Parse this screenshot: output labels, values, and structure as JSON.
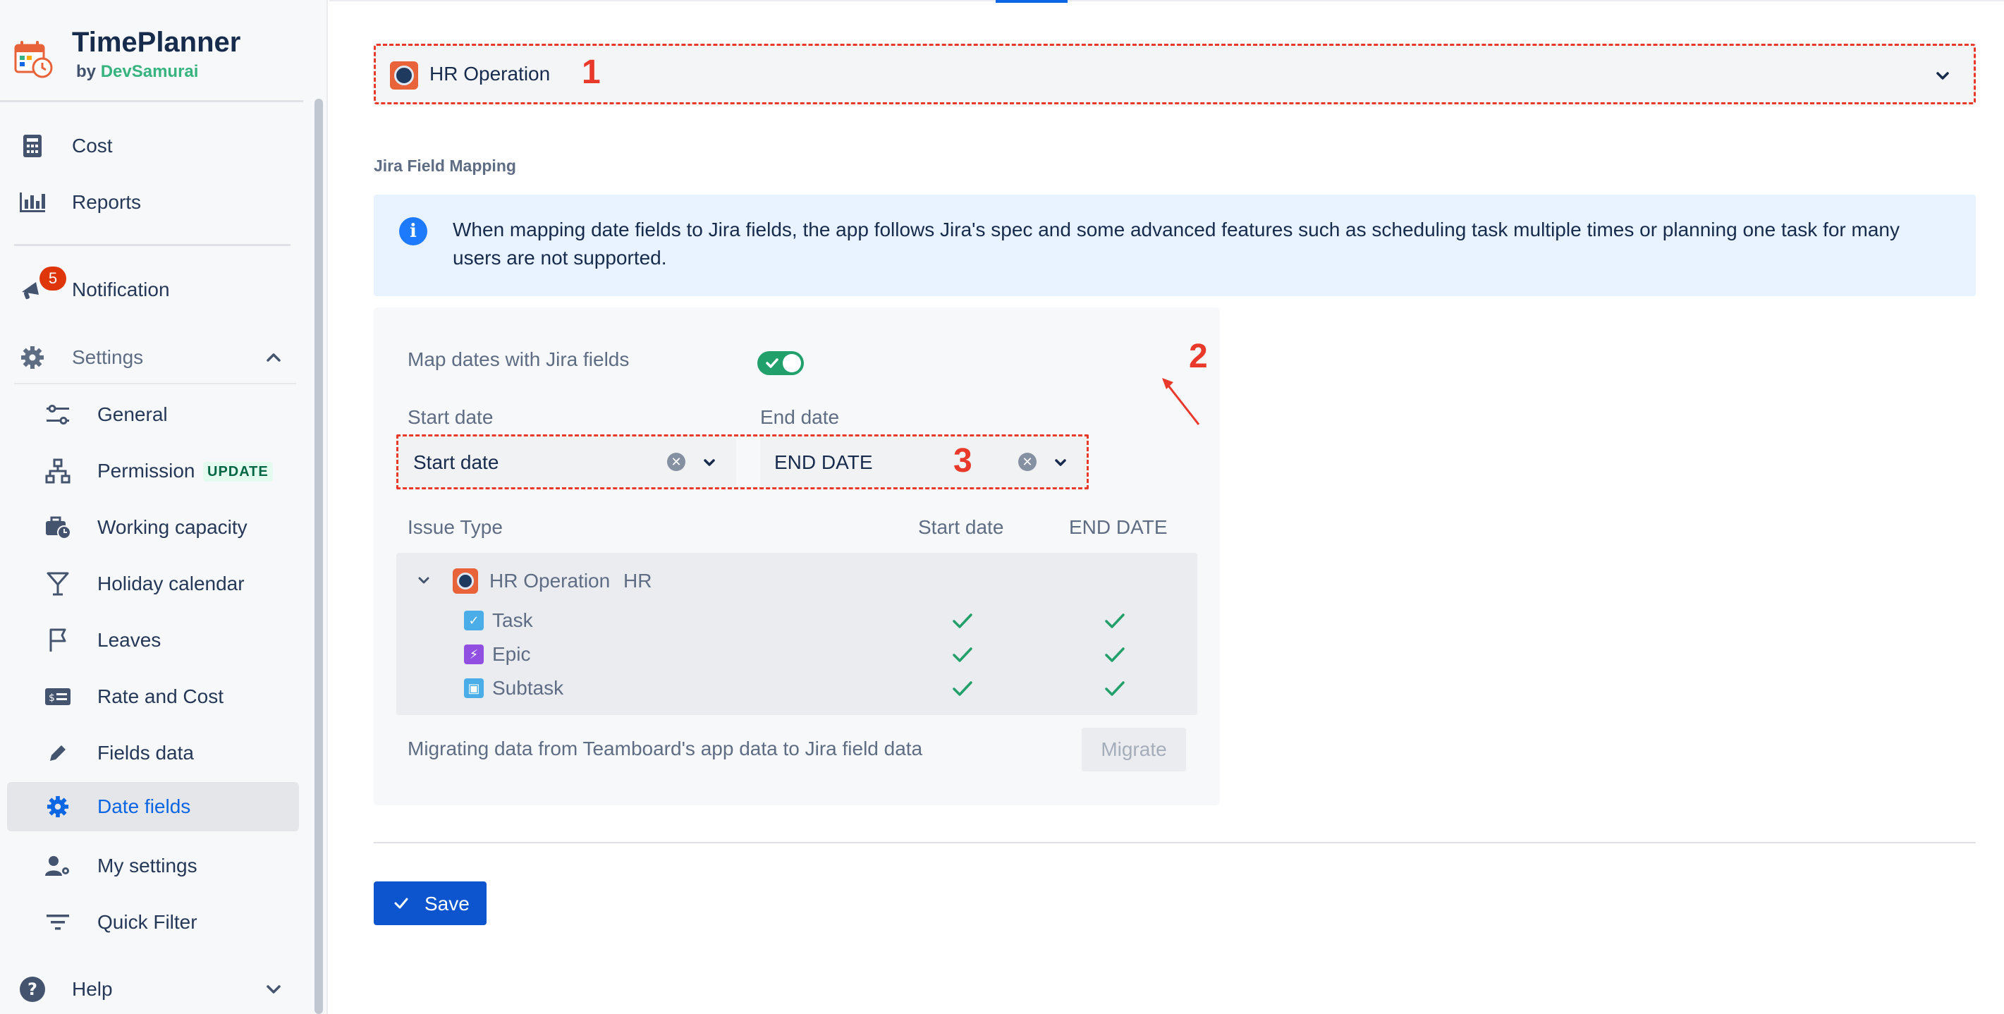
{
  "brand": {
    "title": "TimePlanner",
    "by": "by",
    "company": "DevSamurai"
  },
  "sidebar": {
    "top_items": [
      {
        "label": "Cost",
        "icon": "cost-icon"
      },
      {
        "label": "Reports",
        "icon": "reports-icon"
      }
    ],
    "notification": {
      "label": "Notification",
      "count": "5"
    },
    "settings": {
      "label": "Settings",
      "items": [
        {
          "label": "General",
          "icon": "sliders-icon"
        },
        {
          "label": "Permission",
          "icon": "hierarchy-icon",
          "badge": "UPDATE"
        },
        {
          "label": "Working capacity",
          "icon": "briefcase-clock-icon"
        },
        {
          "label": "Holiday calendar",
          "icon": "glass-icon"
        },
        {
          "label": "Leaves",
          "icon": "flag-icon"
        },
        {
          "label": "Rate and Cost",
          "icon": "money-card-icon"
        },
        {
          "label": "Fields data",
          "icon": "pencil-icon"
        },
        {
          "label": "Date fields",
          "icon": "gear-icon",
          "active": true
        },
        {
          "label": "My settings",
          "icon": "user-gear-icon"
        },
        {
          "label": "Quick Filter",
          "icon": "filter-icon"
        }
      ]
    },
    "help": {
      "label": "Help"
    }
  },
  "main": {
    "project": {
      "name": "HR Operation",
      "annotation": "1"
    },
    "section_title": "Jira Field Mapping",
    "info": "When mapping date fields to Jira fields, the app follows Jira's spec and some advanced features such as scheduling task multiple times or planning one task for many users are not supported.",
    "map_label": "Map dates with Jira fields",
    "toggle_annotation": "2",
    "fields_annotation": "3",
    "start_label": "Start date",
    "end_label": "End date",
    "start_value": "Start date",
    "end_value": "END DATE",
    "table": {
      "headers": [
        "Issue Type",
        "Start date",
        "END DATE"
      ],
      "project_row": {
        "name": "HR Operation",
        "key": "HR"
      },
      "rows": [
        {
          "label": "Task",
          "icon": "task-icon"
        },
        {
          "label": "Epic",
          "icon": "epic-icon"
        },
        {
          "label": "Subtask",
          "icon": "subtask-icon"
        }
      ]
    },
    "migrate_text": "Migrating data from Teamboard's app data to Jira field data",
    "migrate_button": "Migrate",
    "save_button": "Save"
  },
  "colors": {
    "accent": "#0c66e4",
    "annotation": "#e8392b",
    "toggle_on": "#22a06b",
    "check": "#22a06b"
  }
}
